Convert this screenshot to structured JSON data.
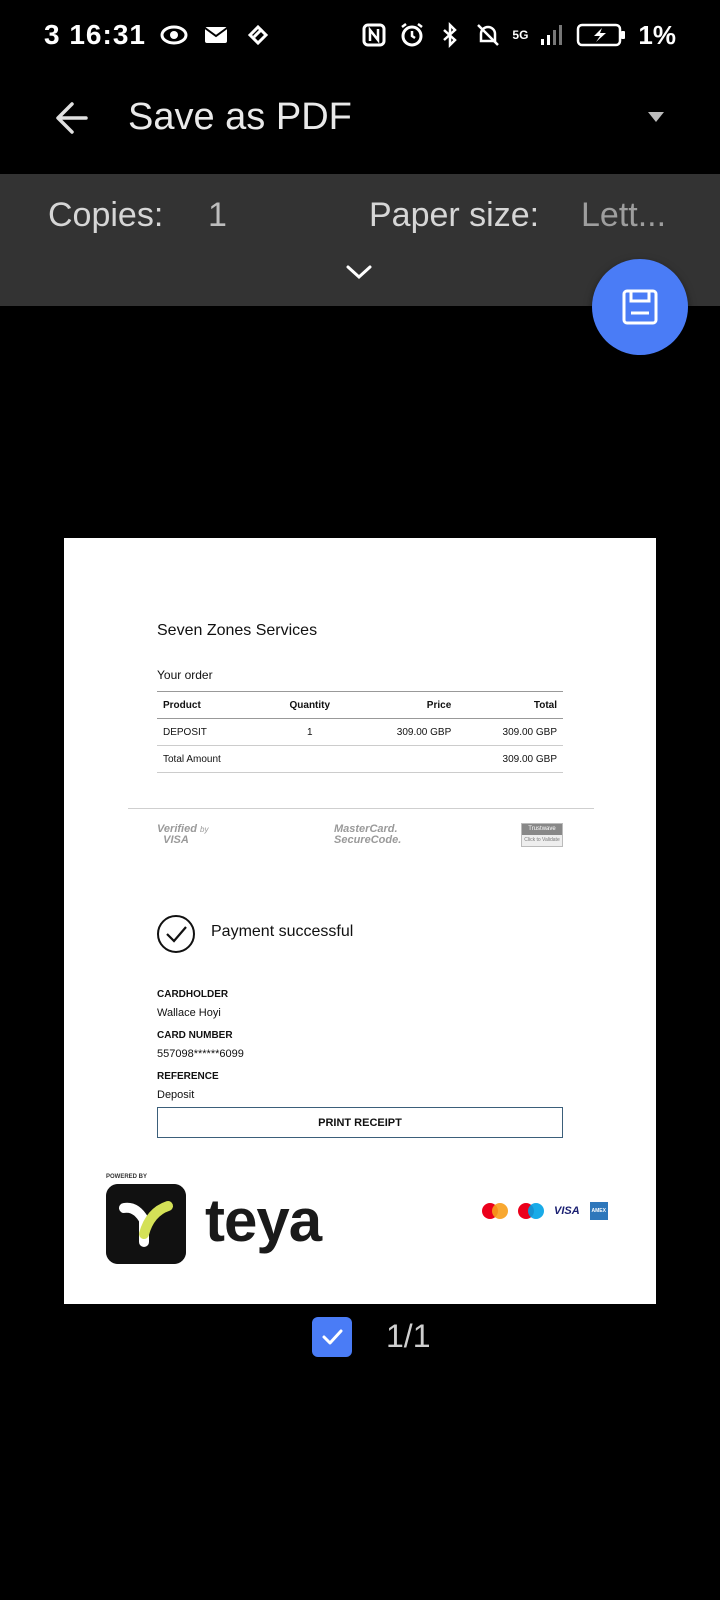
{
  "status_bar": {
    "time": "3 16:31",
    "network": "5G",
    "battery": "1%",
    "icons": [
      "eye-icon",
      "mail-icon",
      "app-icon",
      "nfc-icon",
      "alarm-icon",
      "bluetooth-icon",
      "bell-off-icon",
      "signal-icon",
      "battery-charging-icon"
    ]
  },
  "appbar": {
    "title": "Save as PDF",
    "back_icon": "arrow-back-icon",
    "dropdown_icon": "dropdown-arrow-icon"
  },
  "options": {
    "copies_label": "Copies:",
    "copies_value": "1",
    "paper_label": "Paper size:",
    "paper_value": "Lett...",
    "expand_icon": "chevron-down-icon"
  },
  "fab": {
    "icon": "save-icon",
    "color": "#4a7cf6"
  },
  "document": {
    "merchant": "Seven Zones Services",
    "your_order": "Your order",
    "table": {
      "headers": [
        "Product",
        "Quantity",
        "Price",
        "Total"
      ],
      "rows": [
        [
          "DEPOSIT",
          "1",
          "309.00 GBP",
          "309.00 GBP"
        ],
        [
          "Total Amount",
          "",
          "",
          "309.00 GBP"
        ]
      ]
    },
    "security_badges": {
      "visa_line1": "Verified",
      "visa_by": "by",
      "visa_line2": "VISA",
      "mastercard_line1": "MasterCard.",
      "mastercard_line2": "SecureCode.",
      "trustwave_top": "Trustwave",
      "trustwave_bottom": "Click to Validate"
    },
    "payment_status": "Payment successful",
    "cardholder_label": "CARDHOLDER",
    "cardholder_value": "Wallace Hoyi",
    "card_number_label": "CARD NUMBER",
    "card_number_value": "557098******6099",
    "reference_label": "REFERENCE",
    "reference_value": "Deposit",
    "print_button": "PRINT RECEIPT",
    "powered_by": "POWERED BY",
    "brand": "teya",
    "card_logos": [
      "mastercard-logo",
      "maestro-logo",
      "visa-logo",
      "amex-logo"
    ],
    "visa_logo_text": "VISA",
    "amex_logo_text": "AMEX"
  },
  "page_selector": {
    "checked": true,
    "page_label": "1/1"
  }
}
